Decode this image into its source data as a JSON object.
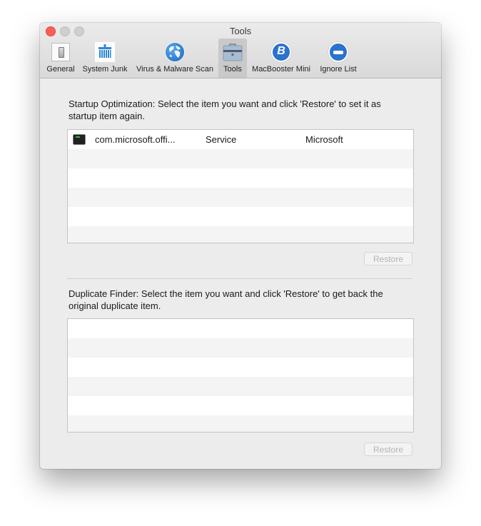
{
  "window": {
    "title": "Tools"
  },
  "toolbar": {
    "tabs": [
      {
        "label": "General",
        "icon": "switch-icon",
        "selected": false
      },
      {
        "label": "System Junk",
        "icon": "broom-icon",
        "selected": false
      },
      {
        "label": "Virus & Malware Scan",
        "icon": "globe-icon",
        "selected": false
      },
      {
        "label": "Tools",
        "icon": "toolbox-icon",
        "selected": true
      },
      {
        "label": "MacBooster Mini",
        "icon": "macbooster-b-icon",
        "selected": false
      },
      {
        "label": "Ignore List",
        "icon": "minus-circle-icon",
        "selected": false
      }
    ]
  },
  "startup": {
    "description": "Startup Optimization: Select the item you want and click 'Restore' to set it as startup item again.",
    "rows": [
      {
        "icon": "terminal-icon",
        "name": "com.microsoft.offi...",
        "type": "Service",
        "vendor": "Microsoft"
      }
    ],
    "restore_label": "Restore"
  },
  "duplicate": {
    "description": "Duplicate Finder:  Select the item you want and click 'Restore' to get back the original duplicate item.",
    "rows": [],
    "restore_label": "Restore"
  },
  "colors": {
    "accent_blue": "#2b73cc",
    "close_red": "#fc5f57",
    "window_bg": "#ececec"
  }
}
